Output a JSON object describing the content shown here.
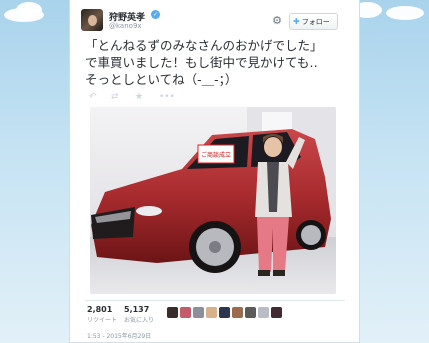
{
  "tweet": {
    "display_name": "狩野英孝",
    "handle": "@kano9x",
    "follow_label": "フォロー",
    "text_lines": [
      "「とんねるずのみなさんのおかげでした」",
      "で車買いました！もし街中で見かけても‥",
      "そっとしといてね（-＿-；）"
    ],
    "car_plate": "ご商談成立",
    "retweets": {
      "count": "2,801",
      "label": "リツイート"
    },
    "favorites": {
      "count": "5,137",
      "label": "お気に入り"
    },
    "timestamp": "1:53 - 2015年6月29日",
    "icons": {
      "verified": "verified-badge-icon",
      "settings": "gear-icon",
      "follow": "bird-icon",
      "reply": "reply-icon",
      "retweet": "retweet-icon",
      "favorite": "star-icon",
      "more": "more-icon"
    }
  },
  "colors": {
    "background": "#c0deed",
    "text": "#292f33",
    "meta": "#8899a6",
    "accent": "#55acee",
    "car_red": "#a82b2e"
  }
}
